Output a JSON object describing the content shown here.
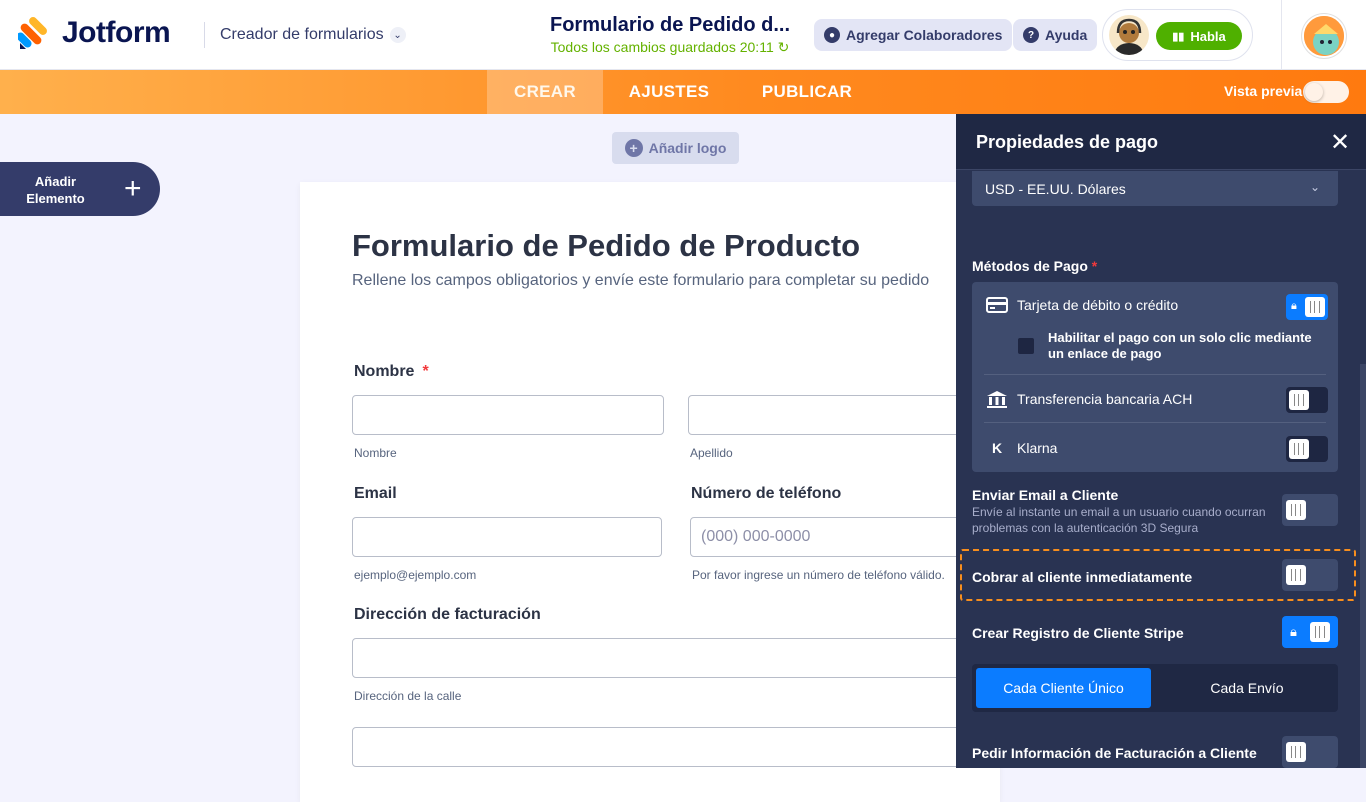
{
  "header": {
    "brand": "Jotform",
    "builder_label": "Creador de formularios",
    "form_title": "Formulario de Pedido d...",
    "save_status": "Todos los cambios guardados 20:11",
    "collab_label": "Agregar Colaboradores",
    "help_label": "Ayuda",
    "talk_label": "Habla",
    "talk_icon": "sound-bars-icon"
  },
  "nav": {
    "tabs": [
      {
        "label": "CREAR"
      },
      {
        "label": "AJUSTES"
      },
      {
        "label": "PUBLICAR"
      }
    ],
    "preview_label": "Vista previa"
  },
  "canvas": {
    "add_logo": "Añadir logo",
    "add_element": "Añadir Elemento",
    "form": {
      "title": "Formulario de Pedido de Producto",
      "subtitle": "Rellene los campos obligatorios y envíe este formulario para completar su pedido",
      "name_label": "Nombre",
      "required_mark": "*",
      "first_sub": "Nombre",
      "last_sub": "Apellido",
      "email_label": "Email",
      "email_sub": "ejemplo@ejemplo.com",
      "phone_label": "Número de teléfono",
      "phone_placeholder": "(000) 000-0000",
      "phone_sub": "Por favor ingrese un número de teléfono válido.",
      "billing_label": "Dirección de facturación",
      "street_sub": "Dirección de la calle"
    }
  },
  "panel": {
    "title": "Propiedades de pago",
    "close": "✕",
    "currency": "USD - EE.UU. Dólares",
    "methods_label": "Métodos de Pago",
    "required_mark": "*",
    "methods": [
      {
        "label": "Tarjeta de débito o crédito",
        "icon": "credit-card-icon",
        "enabled": true,
        "locked": true
      },
      {
        "label": "Transferencia bancaria ACH",
        "icon": "bank-icon",
        "enabled": false
      },
      {
        "label": "Klarna",
        "icon": "klarna-icon",
        "enabled": false
      }
    ],
    "one_click": "Habilitar el pago con un solo clic mediante un enlace de pago",
    "send_email_label": "Enviar Email a Cliente",
    "send_email_desc": "Envíe al instante un email a un usuario cuando ocurran problemas con la autenticación 3D Segura",
    "charge_label": "Cobrar al cliente inmediatamente",
    "stripe_label": "Crear Registro de Cliente Stripe",
    "seg_a": "Cada Cliente Único",
    "seg_b": "Cada Envío",
    "billing_info_label": "Pedir Información de Facturación a Cliente",
    "colors": {
      "accent_orange": "#ff8a1f",
      "toggle_on": "#0b7cff",
      "panel_bg": "#293352"
    }
  }
}
